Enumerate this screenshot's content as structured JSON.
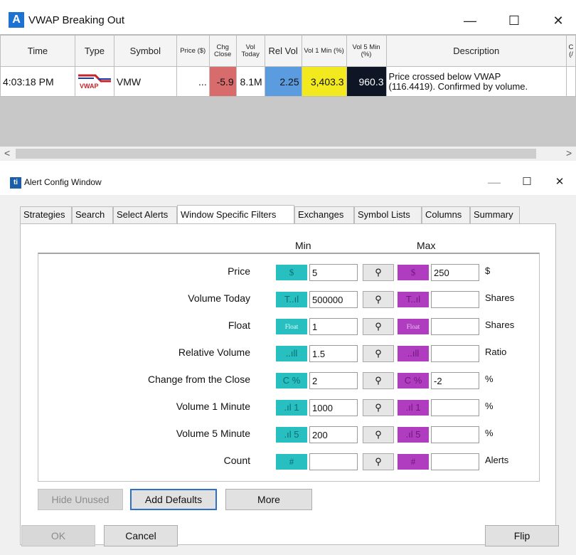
{
  "top_window": {
    "title": "VWAP Breaking Out",
    "controls": {
      "minimize": "—",
      "maximize": "☐",
      "close": "✕"
    },
    "columns": [
      "Time",
      "Type",
      "Symbol",
      "Price ($)",
      "Chg Close",
      "Vol Today",
      "Rel Vol",
      "Vol 1 Min (%)",
      "Vol 5 Min (%)",
      "Description",
      "C (/"
    ],
    "row": {
      "time": "4:03:18 PM",
      "type_badge": "VWAP",
      "symbol": "VMW",
      "price": "...",
      "chg_close": "-5.9",
      "vol_today": "8.1M",
      "rel_vol": "2.25",
      "vol_1min": "3,403.3",
      "vol_5min": "960.3",
      "description_line1": "Price crossed below VWAP",
      "description_line2": "(116.4419).  Confirmed by volume."
    },
    "colors": {
      "chg_close_bg": "#d86b6b",
      "rel_vol_bg": "#5b9be0",
      "vol_1min_bg": "#f2ea1f",
      "vol_5min_bg": "#0e1525"
    },
    "scroll_left": "<",
    "scroll_right": ">"
  },
  "config_window": {
    "title": "Alert Config Window",
    "controls": {
      "minimize": "—",
      "maximize": "☐",
      "close": "✕"
    },
    "tabs": [
      "Strategies",
      "Search",
      "Select Alerts",
      "Window Specific Filters",
      "Exchanges",
      "Symbol Lists",
      "Columns",
      "Summary"
    ],
    "active_tab": "Window Specific Filters",
    "min_header": "Min",
    "max_header": "Max",
    "filters": [
      {
        "label": "Price",
        "icon": "$",
        "min": "5",
        "max": "250",
        "unit": "$"
      },
      {
        "label": "Volume Today",
        "icon": "T..ıl",
        "min": "500000",
        "max": "",
        "unit": "Shares"
      },
      {
        "label": "Float",
        "icon": "Float",
        "min": "1",
        "max": "",
        "unit": "Shares"
      },
      {
        "label": "Relative Volume",
        "icon": "..ıll",
        "min": "1.5",
        "max": "",
        "unit": "Ratio"
      },
      {
        "label": "Change from the Close",
        "icon": "C %",
        "min": "2",
        "max": "-2",
        "unit": "%"
      },
      {
        "label": "Volume 1 Minute",
        "icon": ".ıl 1",
        "min": "1000",
        "max": "",
        "unit": "%"
      },
      {
        "label": "Volume 5 Minute",
        "icon": ".ıl 5",
        "min": "200",
        "max": "",
        "unit": "%"
      },
      {
        "label": "Count",
        "icon": "#",
        "min": "",
        "max": "",
        "unit": "Alerts"
      }
    ],
    "search_glyph": "⚲",
    "buttons": {
      "hide_unused": "Hide Unused",
      "add_defaults": "Add Defaults",
      "more": "More",
      "ok": "OK",
      "cancel": "Cancel",
      "flip": "Flip"
    }
  }
}
